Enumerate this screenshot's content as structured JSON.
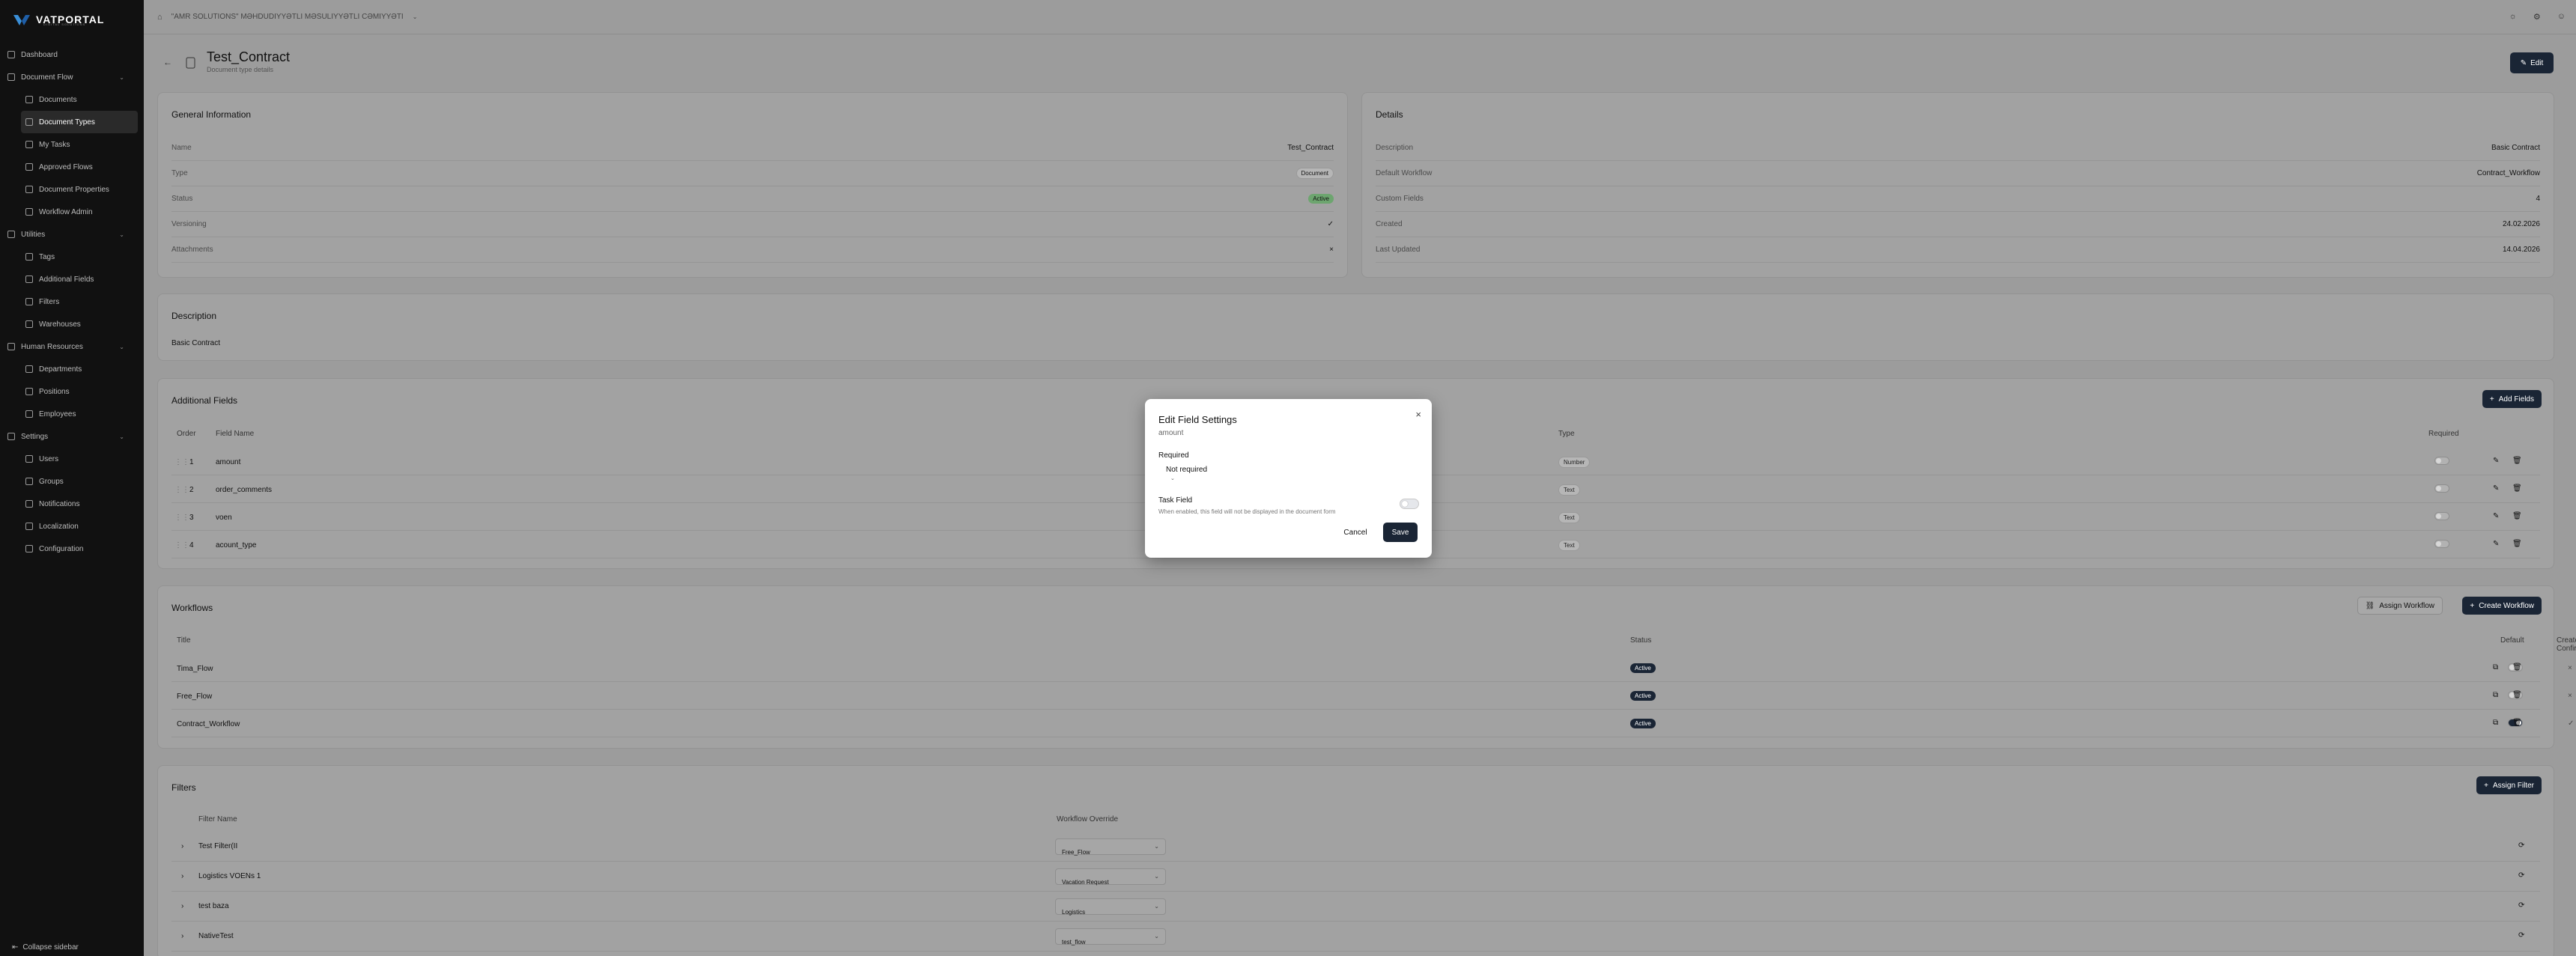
{
  "app": {
    "logo_text": "VATPORTAL",
    "logo_sub": "DIGITAL SOLUTIONS",
    "company": "\"AMR SOLUTIONS\" MƏHDUDIYYƏTLI MƏSULIYYƏTLI CƏMIYYƏTI"
  },
  "sidebar": {
    "items": [
      {
        "label": "Dashboard",
        "icon": "dashboard-icon"
      },
      {
        "label": "Document Flow",
        "icon": "document-flow-icon",
        "group": true
      },
      {
        "label": "Documents",
        "icon": "file-icon"
      },
      {
        "label": "Document Types",
        "icon": "file-type-icon",
        "active": true
      },
      {
        "label": "My Tasks",
        "icon": "tasks-icon"
      },
      {
        "label": "Approved Flows",
        "icon": "check-icon"
      },
      {
        "label": "Document Properties",
        "icon": "properties-icon"
      },
      {
        "label": "Workflow Admin",
        "icon": "workflow-icon"
      },
      {
        "label": "Utilities",
        "icon": "wrench-icon",
        "group": true
      },
      {
        "label": "Tags",
        "icon": "tag-icon"
      },
      {
        "label": "Additional Fields",
        "icon": "fields-icon"
      },
      {
        "label": "Filters",
        "icon": "filter-icon"
      },
      {
        "label": "Warehouses",
        "icon": "warehouse-icon"
      },
      {
        "label": "Human Resources",
        "icon": "people-icon",
        "group": true
      },
      {
        "label": "Departments",
        "icon": "building-icon"
      },
      {
        "label": "Positions",
        "icon": "briefcase-icon"
      },
      {
        "label": "Employees",
        "icon": "user-icon"
      },
      {
        "label": "Settings",
        "icon": "gear-icon",
        "group": true
      },
      {
        "label": "Users",
        "icon": "users-icon"
      },
      {
        "label": "Groups",
        "icon": "group-icon"
      },
      {
        "label": "Notifications",
        "icon": "bell-icon"
      },
      {
        "label": "Localization",
        "icon": "globe-icon"
      },
      {
        "label": "Configuration",
        "icon": "config-icon"
      }
    ],
    "collapse_label": "Collapse sidebar"
  },
  "header": {
    "title": "Test_Contract",
    "subtitle": "Document type details",
    "edit_label": "Edit"
  },
  "general": {
    "title": "General Information",
    "rows": [
      {
        "key": "Name",
        "value": "Test_Contract"
      },
      {
        "key": "Type",
        "value": "Document"
      },
      {
        "key": "Status",
        "value": "Active"
      },
      {
        "key": "Versioning",
        "value": "✓"
      },
      {
        "key": "Attachments",
        "value": "×"
      }
    ]
  },
  "details": {
    "title": "Details",
    "rows": [
      {
        "key": "Description",
        "value": "Basic Contract"
      },
      {
        "key": "Default Workflow",
        "value": "Contract_Workflow"
      },
      {
        "key": "Custom Fields",
        "value": "4"
      },
      {
        "key": "Created",
        "value": "24.02.2026"
      },
      {
        "key": "Last Updated",
        "value": "14.04.2026"
      }
    ]
  },
  "description": {
    "title": "Description",
    "text": "Basic Contract"
  },
  "additional_fields": {
    "title": "Additional Fields",
    "add_label": "Add Fields",
    "columns": [
      "Order",
      "Field Name",
      "Type",
      "Required"
    ],
    "rows": [
      {
        "order": "1",
        "name": "amount",
        "type": "Number"
      },
      {
        "order": "2",
        "name": "order_comments",
        "type": "Text"
      },
      {
        "order": "3",
        "name": "voen",
        "type": "Text"
      },
      {
        "order": "4",
        "name": "acount_type",
        "type": "Text"
      }
    ]
  },
  "workflows": {
    "title": "Workflows",
    "assign_label": "Assign Workflow",
    "create_label": "Create Workflow",
    "columns": [
      "Title",
      "Status",
      "Default",
      "Creator Confirm"
    ],
    "rows": [
      {
        "title": "Tima_Flow",
        "status": "Active",
        "confirm": "×",
        "default": false
      },
      {
        "title": "Free_Flow",
        "status": "Active",
        "confirm": "×",
        "default": false
      },
      {
        "title": "Contract_Workflow",
        "status": "Active",
        "confirm": "✓",
        "default": true
      }
    ]
  },
  "filters": {
    "title": "Filters",
    "assign_label": "Assign Filter",
    "columns": [
      "Filter Name",
      "Workflow Override"
    ],
    "rows": [
      {
        "name": "Test Filter(II",
        "override": "Free_Flow"
      },
      {
        "name": "Logistics VOENs 1",
        "override": "Vacation Request"
      },
      {
        "name": "test baza",
        "override": "Logistics"
      },
      {
        "name": "NativeTest",
        "override": "test_flow"
      }
    ]
  },
  "modal": {
    "title": "Edit Field Settings",
    "subtitle": "amount",
    "required_label": "Required",
    "required_value": "Not required",
    "task_label": "Task Field",
    "task_hint": "When enabled, this field will not be displayed in the document form",
    "cancel_label": "Cancel",
    "save_label": "Save"
  }
}
